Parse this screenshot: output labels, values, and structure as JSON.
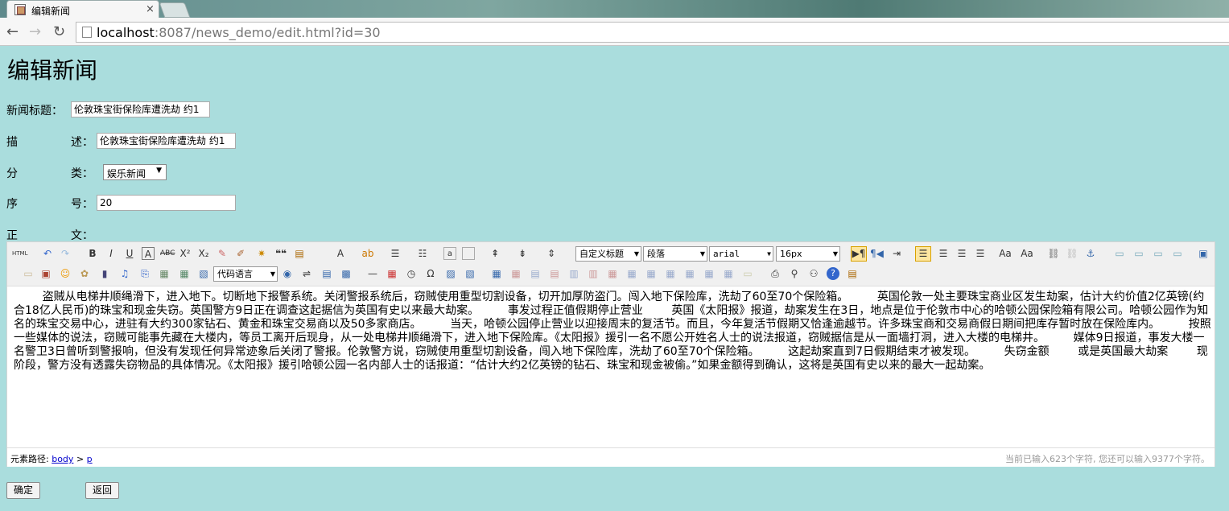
{
  "browser": {
    "tab_title": "编辑新闻",
    "tab_close": "×",
    "url_host": "localhost",
    "url_rest": ":8087/news_demo/edit.html?id=30"
  },
  "page": {
    "heading": "编辑新闻",
    "form": {
      "title_label": "新闻标题：",
      "title_value": "伦敦珠宝街保险库遭洗劫 约1",
      "desc_label_a": "描",
      "desc_label_b": "述：",
      "desc_value": "伦敦珠宝街保险库遭洗劫 约1",
      "cat_label_a": "分",
      "cat_label_b": "类：",
      "cat_value": "娱乐新闻",
      "order_label_a": "序",
      "order_label_b": "号：",
      "order_value": "20",
      "body_label_a": "正",
      "body_label_b": "文："
    },
    "editor": {
      "code_lang": "代码语言",
      "custom_title": "自定义标题",
      "paragraph": "段落",
      "font_family": "arial",
      "font_size": "16px",
      "content": "        盗贼从电梯井顺绳滑下，进入地下。切断地下报警系统。关闭警报系统后，窃贼使用重型切割设备，切开加厚防盗门。闯入地下保险库，洗劫了60至70个保险箱。        英国伦敦一处主要珠宝商业区发生劫案，估计大约价值2亿英镑(约合18亿人民币)的珠宝和现金失窃。英国警方9日正在调查这起据信为英国有史以来最大劫案。        事发过程正值假期停止营业        英国《太阳报》报道，劫案发生在3日，地点是位于伦敦市中心的哈顿公园保险箱有限公司。哈顿公园作为知名的珠宝交易中心，进驻有大约300家钻石、黄金和珠宝交易商以及50多家商店。        当天，哈顿公园停止营业以迎接周末的复活节。而且，今年复活节假期又恰逢逾越节。许多珠宝商和交易商假日期间把库存暂时放在保险库内。        按照一些媒体的说法，窃贼可能事先藏在大楼内，等员工离开后现身，从一处电梯井顺绳滑下，进入地下保险库。《太阳报》援引一名不愿公开姓名人士的说法报道，窃贼据信是从一面墙打洞，进入大楼的电梯井。        媒体9日报道，事发大楼一名警卫3日曾听到警报响，但没有发现任何异常迹象后关闭了警报。伦敦警方说，窃贼使用重型切割设备，闯入地下保险库，洗劫了60至70个保险箱。        这起劫案直到7日假期结束才被发现。        失窃金额        或是英国最大劫案        现阶段，警方没有透露失窃物品的具体情况。《太阳报》援引哈顿公园一名内部人士的话报道：“估计大约2亿英镑的钻石、珠宝和现金被偷。”如果金额得到确认，这将是英国有史以来的最大一起劫案。",
      "path_label": "元素路径:",
      "path_body": "body",
      "path_sep": ">",
      "path_p": "p",
      "count_text": "当前已输入623个字符, 您还可以输入9377个字符。"
    },
    "buttons": {
      "ok": "确定",
      "back": "返回"
    }
  }
}
